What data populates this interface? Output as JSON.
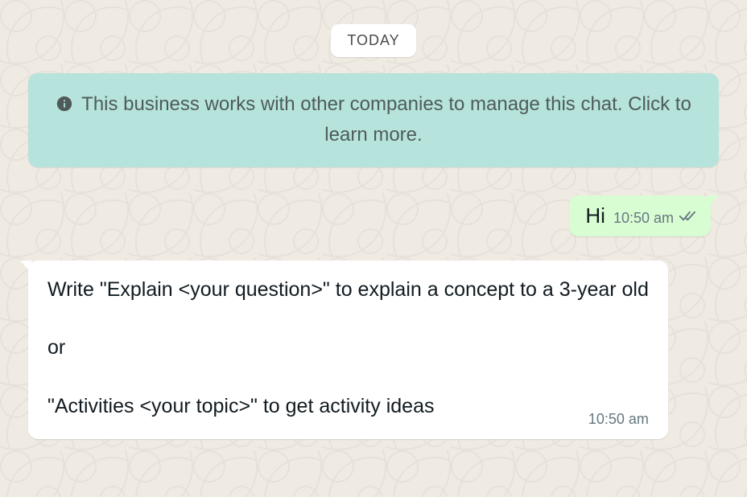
{
  "date_badge": "TODAY",
  "business_notice": {
    "text": "This business works with other companies to manage this chat. Click to learn more."
  },
  "messages": {
    "outgoing": {
      "text": "Hi",
      "time": "10:50 am"
    },
    "incoming": {
      "text": "Write \"Explain <your question>\" to explain a concept to a 3-year old\n\n or\n\n\"Activities <your topic>\" to get activity ideas",
      "time": "10:50 am"
    }
  }
}
